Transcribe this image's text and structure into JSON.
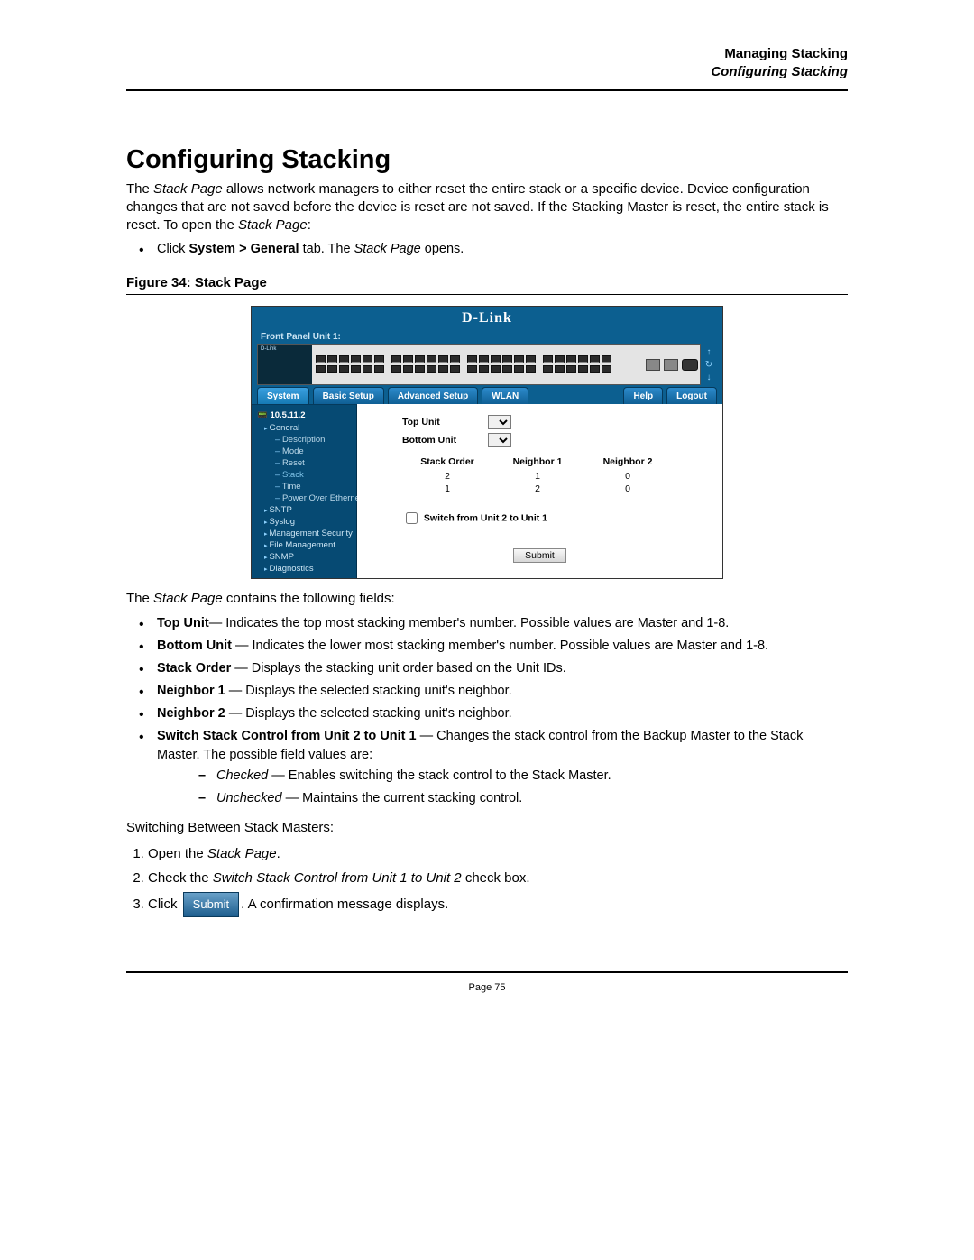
{
  "header": {
    "chapter": "Managing Stacking",
    "section": "Configuring Stacking"
  },
  "title": "Configuring Stacking",
  "intro_parts": {
    "p1a": "The ",
    "p1b": "Stack Page",
    "p1c": " allows network managers to either reset the entire stack or a specific device. Device configuration changes that are not saved before the device is reset are not saved. If the Stacking Master is reset, the entire stack is reset. To open the ",
    "p1d": "Stack Page",
    "p1e": ":"
  },
  "click_line": {
    "a": "Click ",
    "b": "System > General",
    "c": " tab. The ",
    "d": "Stack Page",
    "e": " opens."
  },
  "figure_caption": "Figure 34:  Stack Page",
  "figure": {
    "logo": "D-Link",
    "front_panel": "Front Panel Unit 1:",
    "device_brand": "D-Link",
    "tabs": {
      "system": "System",
      "basic": "Basic Setup",
      "advanced": "Advanced Setup",
      "wlan": "WLAN",
      "help": "Help",
      "logout": "Logout"
    },
    "tree": {
      "ip": "10.5.11.2",
      "general": "General",
      "items": [
        "Description",
        "Mode",
        "Reset",
        "Stack",
        "Time",
        "Power Over Ethernet"
      ],
      "others": [
        "SNTP",
        "Syslog",
        "Management Security",
        "File Management",
        "SNMP",
        "Diagnostics"
      ]
    },
    "form": {
      "top_unit": "Top Unit",
      "bottom_unit": "Bottom Unit"
    },
    "table": {
      "headers": [
        "Stack Order",
        "Neighbor 1",
        "Neighbor 2"
      ],
      "rows": [
        [
          "2",
          "1",
          "0"
        ],
        [
          "1",
          "2",
          "0"
        ]
      ]
    },
    "switch_label": "Switch from Unit 2 to Unit 1",
    "submit": "Submit"
  },
  "fields_intro_a": "The ",
  "fields_intro_b": "Stack Page",
  "fields_intro_c": " contains the following fields:",
  "fields": [
    {
      "b": "Top Unit",
      "t": "— Indicates the top most stacking member's number. Possible values are Master and 1-8."
    },
    {
      "b": "Bottom Unit ",
      "t": "— Indicates the lower most stacking member's number. Possible values are Master and 1-8."
    },
    {
      "b": "Stack Order ",
      "t": "— Displays the stacking unit order based on the Unit IDs."
    },
    {
      "b": "Neighbor 1 ",
      "t": "— Displays the selected stacking unit's neighbor."
    },
    {
      "b": "Neighbor 2 ",
      "t": "— Displays the selected stacking unit's neighbor."
    },
    {
      "b": "Switch Stack Control from Unit 2 to Unit 1 ",
      "t": "— Changes the stack control from the Backup Master to the Stack Master. The possible field values are:"
    }
  ],
  "subfields": [
    {
      "i": "Checked",
      "t": " — Enables switching the stack control to the Stack Master."
    },
    {
      "i": "Unchecked",
      "t": " — Maintains the current stacking control."
    }
  ],
  "switching_heading": "Switching Between Stack Masters:",
  "steps": {
    "s1a": "Open the ",
    "s1b": "Stack Page",
    "s1c": ".",
    "s2a": "Check the ",
    "s2b": "Switch Stack Control from Unit 1 to Unit 2",
    "s2c": " check box.",
    "s3a": "Click ",
    "s3btn": "Submit",
    "s3b": ". A confirmation message displays."
  },
  "page_number": "Page 75"
}
